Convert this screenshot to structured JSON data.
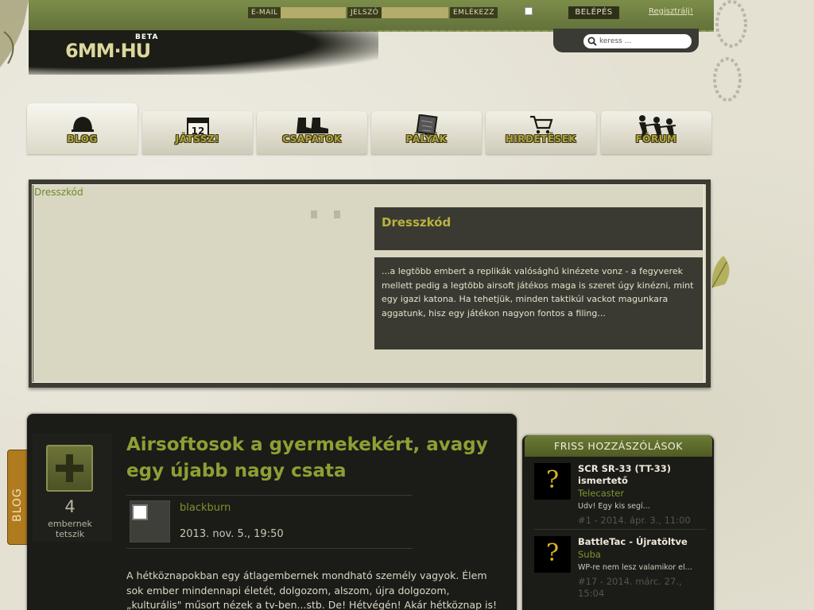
{
  "topbar": {
    "email_label": "E-MAIL",
    "password_label": "JELSZÓ",
    "remember_label": "EMLÉKEZZ",
    "login_label": "BELÉPÉS",
    "register_label": "Regisztrálj!"
  },
  "header": {
    "logo_text": "6MM·HU",
    "beta_label": "BETA",
    "search_placeholder": "keress ..."
  },
  "nav": {
    "items": [
      {
        "label": "BLOG",
        "icon": "helmet-icon",
        "active": true
      },
      {
        "label": "JÁTSSZ!",
        "icon": "calendar-icon",
        "calendar_day": "12"
      },
      {
        "label": "CSAPATOK",
        "icon": "boots-icon"
      },
      {
        "label": "PÁLYÁK",
        "icon": "map-icon"
      },
      {
        "label": "HIRDETÉSEK",
        "icon": "cart-icon"
      },
      {
        "label": "FÓRUM",
        "icon": "soldiers-icon"
      }
    ]
  },
  "featured": {
    "link_text": "Dresszkód",
    "title": "Dresszkód",
    "description": "...a legtöbb embert a replikák valósághű kinézete vonz - a fegyverek mellett pedig a legtöbb airsoft játékos maga is szeret úgy kinézni, mint egy igazi katona. Ha tehetjük, minden taktikúl vackot magunkara aggatunk, hisz egy játékon nagyon fontos a filing..."
  },
  "blog_tab": {
    "label": "BLOG"
  },
  "article": {
    "title": "Airsoftosok a gyermekekért, avagy egy újabb nagy csata",
    "like_count": "4",
    "like_label": "embernek tetszik",
    "author": "blackburn",
    "date": "2013. nov. 5., 19:50",
    "body": "A hétköznapokban  egy átlagembernek mondható személy vagyok.  Élem sok ember mindennapi életét, dolgozom, alszom, újra dolgozom, „kulturális\" műsort nézek a tv-ben...stb. De! Hétvégén! Akár hétköznap is! Amikor szabad"
  },
  "comments": {
    "title": "FRISS HOZZÁSZÓLÁSOK",
    "items": [
      {
        "title": "SCR SR-33 (TT-33) ismertető",
        "author": "Telecaster",
        "snippet": "Üdv!   Egy kis segí...",
        "meta": "#1 - 2014. ápr. 3., 11:00"
      },
      {
        "title": "BattleTac - Újratöltve",
        "author": "Suba",
        "snippet": "WP-re nem lesz valamikor el...",
        "meta": "#17 - 2014. márc. 27., 15:04"
      }
    ]
  },
  "colors": {
    "accent_green": "#8ca034",
    "dark_panel": "#3b3a32",
    "nav_label": "#b0a33b",
    "blog_tab": "#b07a1e"
  }
}
